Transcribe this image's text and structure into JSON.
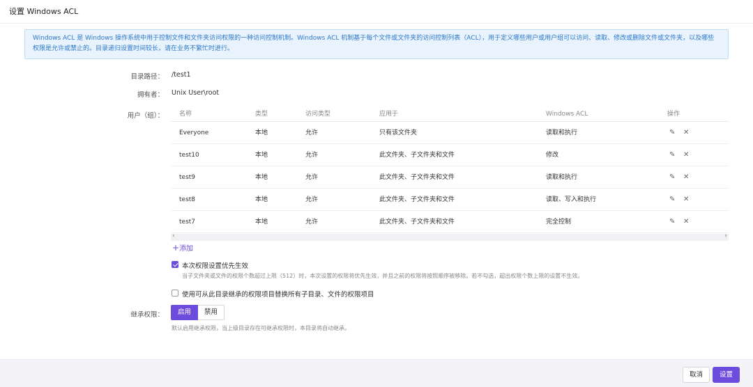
{
  "dialog": {
    "title": "设置 Windows ACL"
  },
  "info": "Windows ACL 是 Windows 操作系统中用于控制文件和文件夹访问权限的一种访问控制机制。Windows ACL 机制基于每个文件或文件夹的访问控制列表（ACL），用于定义哪些用户或用户组可以访问、读取、修改或删除文件或文件夹，以及哪些权限是允许或禁止的。目录递归设置时间较长，请在业务不繁忙时进行。",
  "fields": {
    "path_label": "目录路径：",
    "path_value": "/test1",
    "owner_label": "拥有者：",
    "owner_value": "Unix User\\root",
    "users_label": "用户（组）："
  },
  "table": {
    "headers": [
      "名称",
      "类型",
      "访问类型",
      "应用于",
      "Windows ACL",
      "操作"
    ],
    "rows": [
      {
        "name": "Everyone",
        "type": "本地",
        "access": "允许",
        "apply": "只有该文件夹",
        "acl": "读取和执行"
      },
      {
        "name": "test10",
        "type": "本地",
        "access": "允许",
        "apply": "此文件夹、子文件夹和文件",
        "acl": "修改"
      },
      {
        "name": "test9",
        "type": "本地",
        "access": "允许",
        "apply": "此文件夹、子文件夹和文件",
        "acl": "读取和执行"
      },
      {
        "name": "test8",
        "type": "本地",
        "access": "允许",
        "apply": "此文件夹、子文件夹和文件",
        "acl": "读取、写入和执行"
      },
      {
        "name": "test7",
        "type": "本地",
        "access": "允许",
        "apply": "此文件夹、子文件夹和文件",
        "acl": "完全控制"
      }
    ],
    "scroll_left": "‹",
    "scroll_right": "›"
  },
  "add_label": "添加",
  "options": {
    "priority": {
      "label": "本次权限设置优先生效",
      "checked": true,
      "hint": "当子文件夹或文件的权限个数超过上限（512）时，本次设置的权限将优先生效，并且之前的权限将按照顺序被移除。若不勾选，超出权限个数上限的设置不生效。"
    },
    "replace": {
      "label": "使用可从此目录继承的权限项目替换所有子目录、文件的权限项目",
      "checked": false
    }
  },
  "inherit": {
    "label": "继承权限：",
    "on_label": "启用",
    "off_label": "禁用",
    "hint": "默认启用继承权限，当上级目录存在可继承权限时，本目录将自动继承。"
  },
  "footer": {
    "cancel": "取消",
    "ok": "设置"
  },
  "colors": {
    "accent": "#6b4cdd",
    "info_text": "#2e78c8",
    "info_bg": "#e8f3fe"
  }
}
